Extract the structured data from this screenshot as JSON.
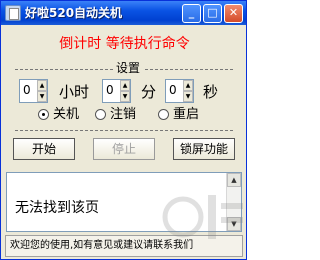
{
  "window": {
    "title": "好啦520自动关机"
  },
  "titlebar_buttons": {
    "minimize": "_",
    "maximize": "□",
    "close": "✕"
  },
  "countdown_label": "倒计时  等待执行命令",
  "settings": {
    "group_title": "设置",
    "hours": {
      "value": "0",
      "unit": "小时"
    },
    "minutes": {
      "value": "0",
      "unit": "分"
    },
    "seconds": {
      "value": "0",
      "unit": "秒"
    },
    "actions": [
      {
        "label": "关机",
        "checked": true
      },
      {
        "label": "注销",
        "checked": false
      },
      {
        "label": "重启",
        "checked": false
      }
    ]
  },
  "buttons": {
    "start": "开始",
    "stop": "停止",
    "lock_screen": "锁屏功能"
  },
  "message_area": {
    "text": "无法找到该页"
  },
  "status_bar": {
    "text": "欢迎您的使用,如有意见或建议请联系我们"
  },
  "icons": {
    "app": "app-window-icon",
    "spin_up": "chevron-up-icon",
    "spin_down": "chevron-down-icon",
    "scroll_up": "scroll-up-arrow-icon",
    "scroll_down": "scroll-down-arrow-icon"
  },
  "colors": {
    "titlebar": "#0a53e4",
    "countdown_text": "#ff0000",
    "window_bg": "#ece9d8"
  }
}
